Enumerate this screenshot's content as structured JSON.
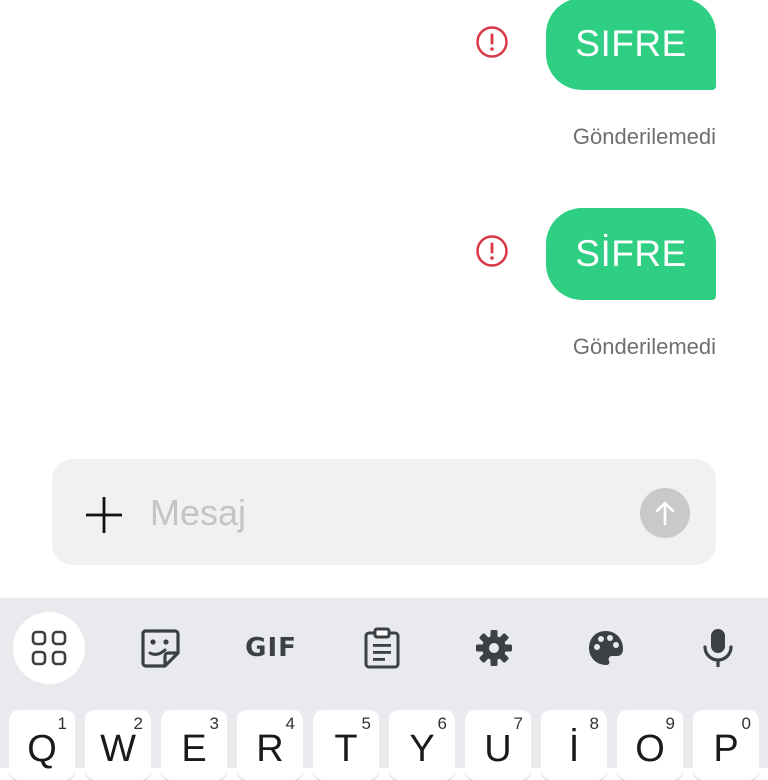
{
  "messages": [
    {
      "text": "SIFRE",
      "status": "Gönderilemedi",
      "error_icon": "error-circle-icon"
    },
    {
      "text": "SİFRE",
      "status": "Gönderilemedi",
      "error_icon": "error-circle-icon"
    }
  ],
  "composer": {
    "placeholder": "Mesaj",
    "add_icon": "plus-icon",
    "send_icon": "arrow-up-icon"
  },
  "keyboard": {
    "toolbar": [
      {
        "icon": "apps-grid-icon"
      },
      {
        "icon": "sticker-icon"
      },
      {
        "icon": "gif-icon",
        "label": "GIF"
      },
      {
        "icon": "clipboard-icon"
      },
      {
        "icon": "settings-gear-icon"
      },
      {
        "icon": "palette-icon"
      },
      {
        "icon": "microphone-icon"
      }
    ],
    "keys": [
      {
        "label": "Q",
        "hint": "1"
      },
      {
        "label": "W",
        "hint": "2"
      },
      {
        "label": "E",
        "hint": "3"
      },
      {
        "label": "R",
        "hint": "4"
      },
      {
        "label": "T",
        "hint": "5"
      },
      {
        "label": "Y",
        "hint": "6"
      },
      {
        "label": "U",
        "hint": "7"
      },
      {
        "label": "İ",
        "hint": "8"
      },
      {
        "label": "O",
        "hint": "9"
      },
      {
        "label": "P",
        "hint": "0"
      }
    ]
  },
  "colors": {
    "bubble": "#2ecf82",
    "error": "#d93848",
    "keyboard_bg": "#e8eaed"
  }
}
